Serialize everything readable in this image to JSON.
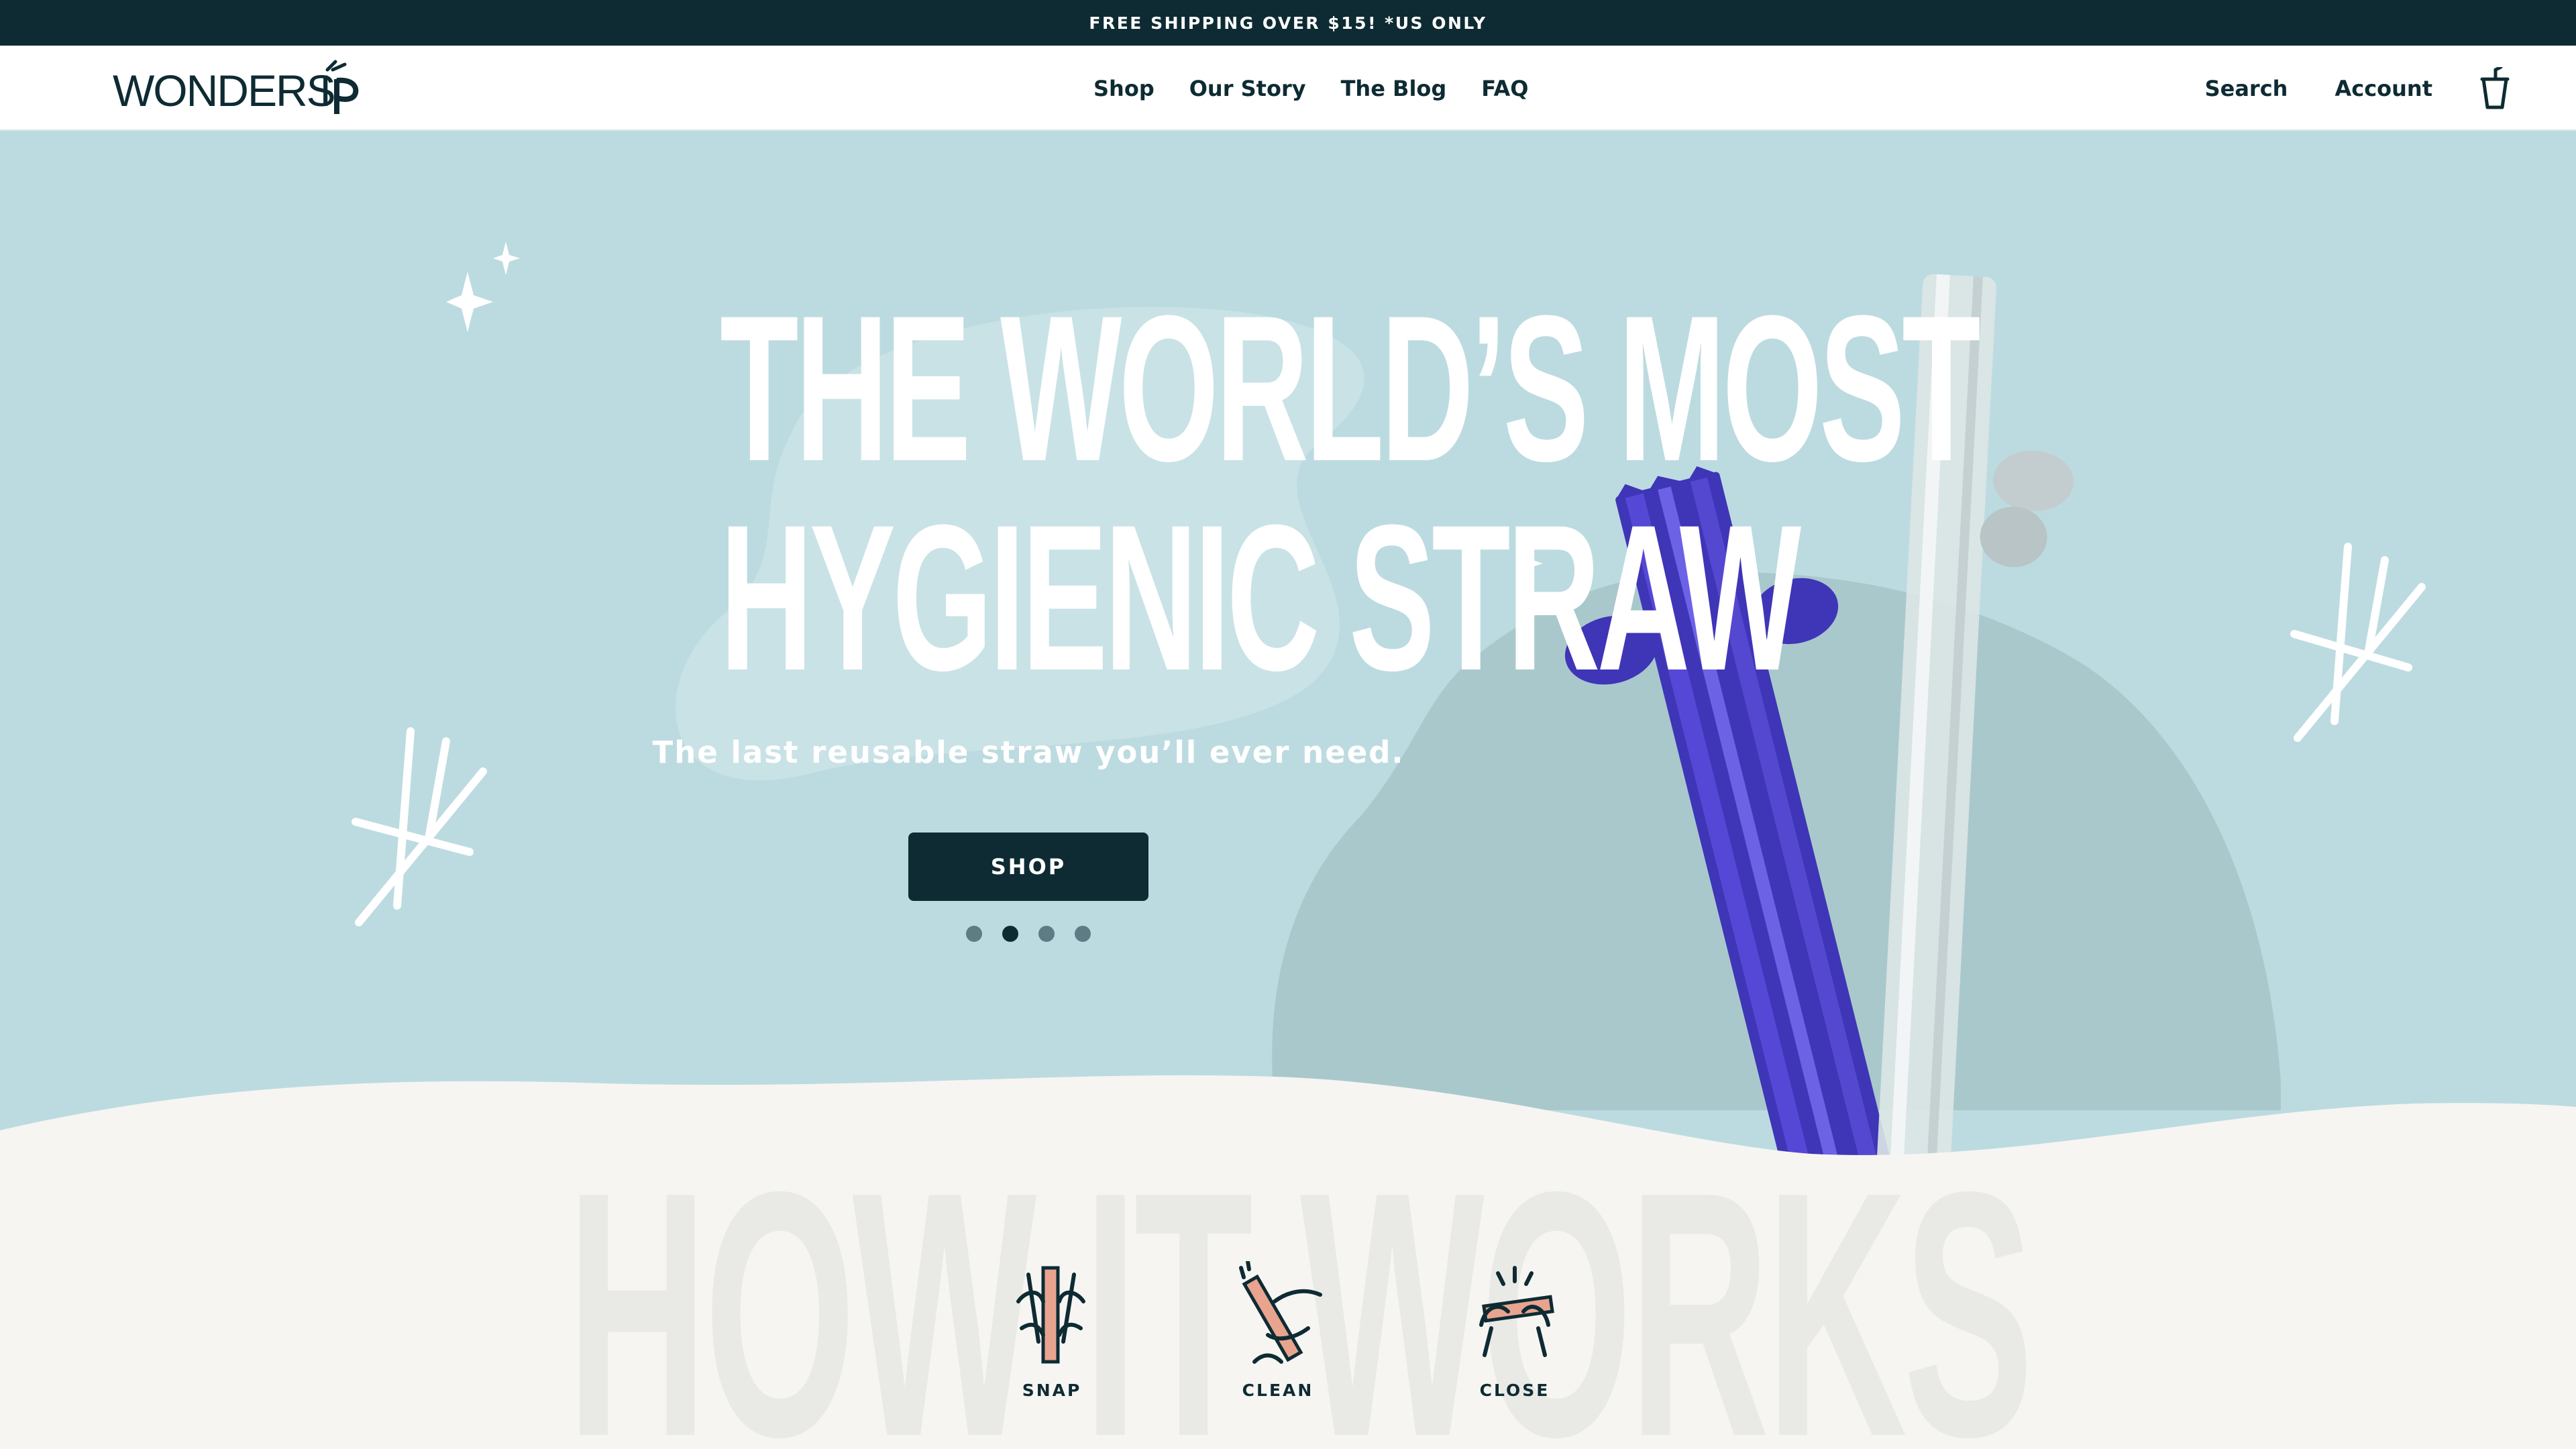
{
  "announcement": "FREE SHIPPING OVER $15! *US ONLY",
  "brand": {
    "logo_text": "WONDERSIP"
  },
  "nav": {
    "links": [
      "Shop",
      "Our Story",
      "The Blog",
      "FAQ"
    ],
    "search_label": "Search",
    "account_label": "Account",
    "cart_icon": "cup-icon"
  },
  "hero": {
    "headline_line1": "THE WORLD’S MOST",
    "headline_line2": "HYGIENIC STRAW",
    "subheading": "The last reusable straw you’ll ever need.",
    "cta_label": "SHOP",
    "slides_total": 4,
    "active_slide": 2
  },
  "how_it_works": {
    "title": "HOW IT WORKS",
    "steps": [
      {
        "label": "SNAP",
        "icon": "snap-straw-icon"
      },
      {
        "label": "CLEAN",
        "icon": "clean-straw-icon"
      },
      {
        "label": "CLOSE",
        "icon": "close-straw-icon"
      }
    ]
  },
  "colors": {
    "dark_teal": "#0e2b33",
    "hero_bg": "#bcdbe0",
    "straw_purple": "#4a3fc6",
    "cream": "#f6f5f2"
  }
}
